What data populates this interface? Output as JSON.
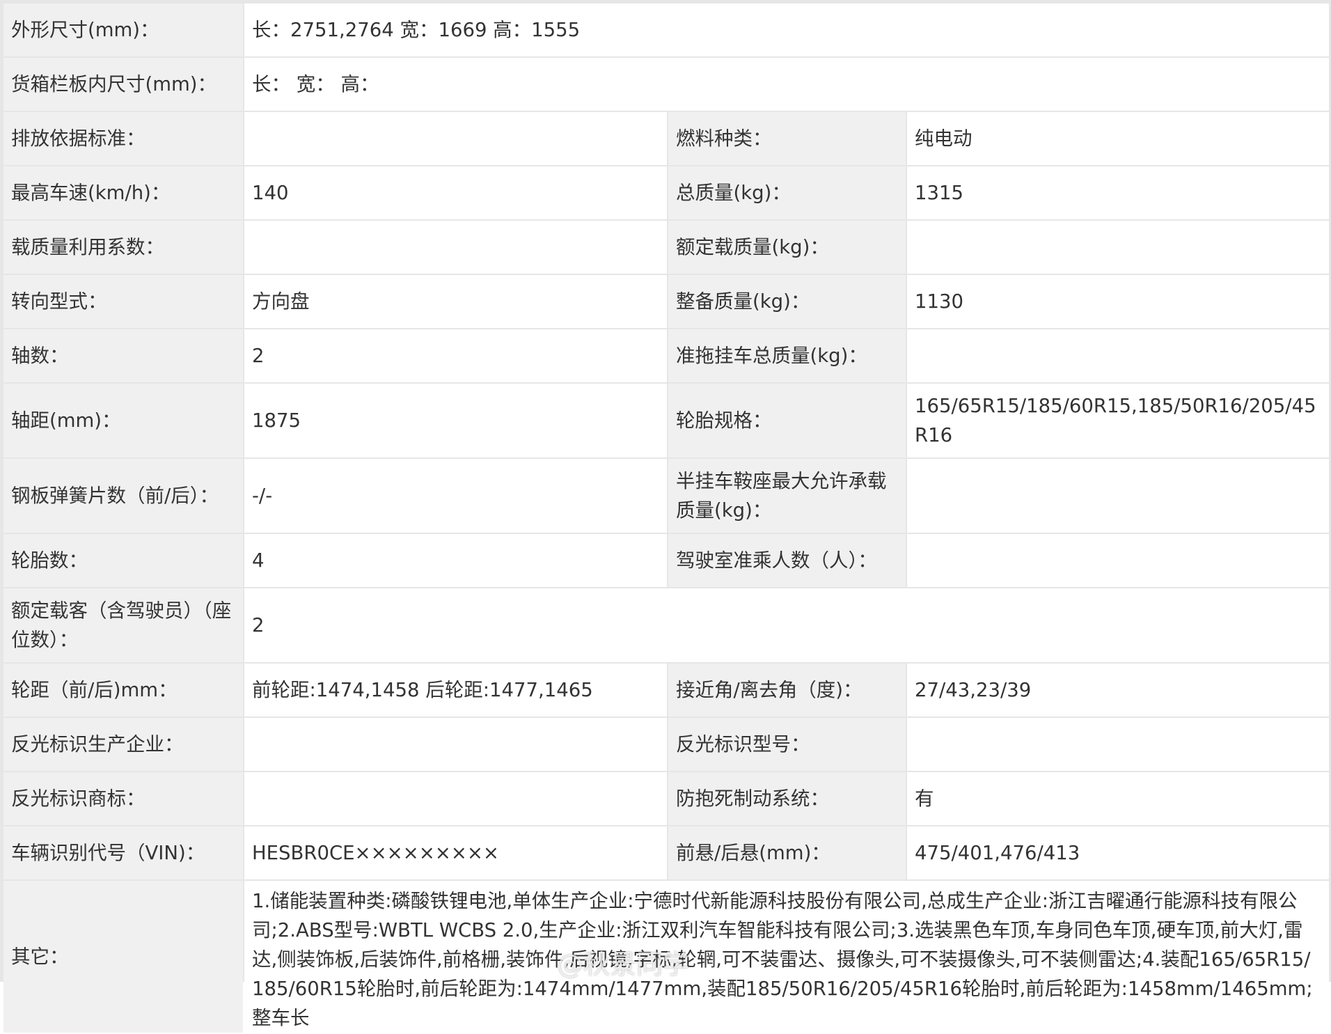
{
  "rows": {
    "dims": {
      "label": "外形尺寸(mm)：",
      "value": "长：2751,2764 宽：1669 高：1555"
    },
    "cargo": {
      "label": "货箱栏板内尺寸(mm)：",
      "value": "长：  宽：  高："
    },
    "emission": {
      "label": "排放依据标准：",
      "value": "",
      "label2": "燃料种类：",
      "value2": "纯电动"
    },
    "speed": {
      "label": "最高车速(km/h)：",
      "value": "140",
      "label2": "总质量(kg)：",
      "value2": "1315"
    },
    "loadcoef": {
      "label": "载质量利用系数：",
      "value": "",
      "label2": "额定载质量(kg)：",
      "value2": ""
    },
    "steering": {
      "label": "转向型式：",
      "value": "方向盘",
      "label2": "整备质量(kg)：",
      "value2": "1130"
    },
    "axles": {
      "label": "轴数：",
      "value": "2",
      "label2": "准拖挂车总质量(kg)：",
      "value2": ""
    },
    "wheelbase": {
      "label": "轴距(mm)：",
      "value": "1875",
      "label2": "轮胎规格：",
      "value2": "165/65R15/185/60R15,185/50R16/205/45R16"
    },
    "springs": {
      "label": "钢板弹簧片数（前/后）：",
      "value": "-/-",
      "label2": "半挂车鞍座最大允许承载质量(kg)：",
      "value2": ""
    },
    "tires": {
      "label": "轮胎数：",
      "value": "4",
      "label2": "驾驶室准乘人数（人）：",
      "value2": ""
    },
    "seats": {
      "label": "额定载客（含驾驶员）（座位数）：",
      "value": "2"
    },
    "track": {
      "label": "轮距（前/后)mm：",
      "value": "前轮距:1474,1458 后轮距:1477,1465",
      "label2": "接近角/离去角（度)：",
      "value2": "27/43,23/39"
    },
    "reflector_maker": {
      "label": "反光标识生产企业：",
      "value": "",
      "label2": "反光标识型号：",
      "value2": ""
    },
    "reflector_brand": {
      "label": "反光标识商标：",
      "value": "",
      "label2": "防抱死制动系统：",
      "value2": "有"
    },
    "vin": {
      "label": "车辆识别代号（VIN)：",
      "value": "HESBR0CE×××××××××",
      "label2": "前悬/后悬(mm)：",
      "value2": "475/401,476/413"
    },
    "other": {
      "label": "其它：",
      "value": "1.储能装置种类:磷酸铁锂电池,单体生产企业:宁德时代新能源科技股份有限公司,总成生产企业:浙江吉曜通行能源科技有限公司;2.ABS型号:WBTL WCBS 2.0,生产企业:浙江双利汽车智能科技有限公司;3.选装黑色车顶,车身同色车顶,硬车顶,前大灯,雷达,侧装饰板,后装饰件,前格栅,装饰件,后视镜,字标,轮辋,可不装雷达、摄像头,可不装摄像头,可不装侧雷达;4.装配165/65R15/185/60R15轮胎时,前后轮距为:1474mm/1477mm,装配185/50R16/205/45R16轮胎时,前后轮距为:1458mm/1465mm;整车长"
    }
  },
  "watermark": "@秋景同学"
}
